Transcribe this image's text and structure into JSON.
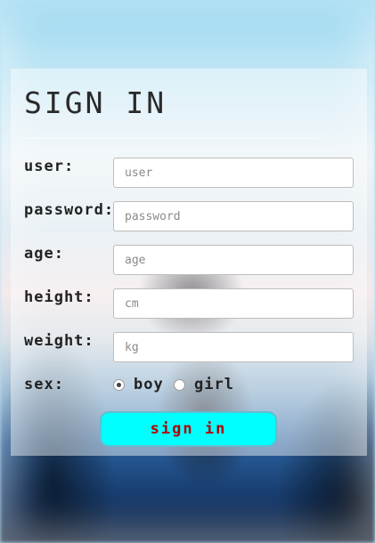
{
  "form": {
    "title": "SIGN IN",
    "fields": [
      {
        "label": "user:",
        "placeholder": "user"
      },
      {
        "label": "password:",
        "placeholder": "password"
      },
      {
        "label": "age:",
        "placeholder": "age"
      },
      {
        "label": "height:",
        "placeholder": "cm"
      },
      {
        "label": "weight:",
        "placeholder": "kg"
      }
    ],
    "sex": {
      "label": "sex:",
      "options": [
        {
          "label": "boy",
          "checked": true
        },
        {
          "label": "girl",
          "checked": false
        }
      ]
    },
    "submit_label": "sign in"
  },
  "colors": {
    "button_bg": "#00ffff",
    "button_text": "#b00000"
  }
}
